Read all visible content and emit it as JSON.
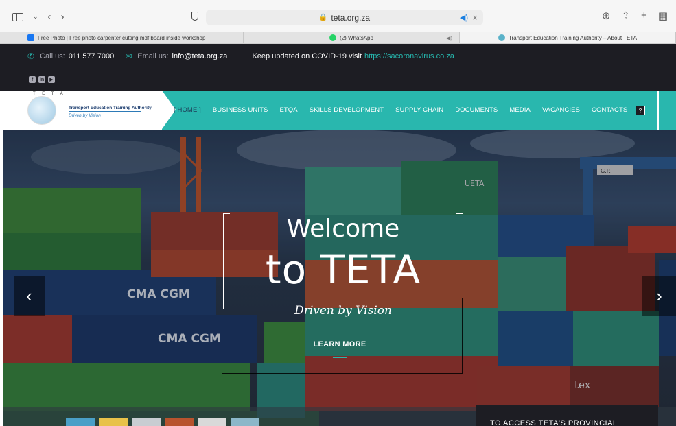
{
  "browser": {
    "url": "teta.org.za",
    "tabs": [
      {
        "label": "Free Photo | Free photo carpenter cutting mdf board inside workshop",
        "icon": "freepik-favicon"
      },
      {
        "label": "(2) WhatsApp",
        "icon": "whatsapp-favicon"
      },
      {
        "label": "Transport Education Training Authority – About TETA",
        "icon": "teta-favicon"
      }
    ]
  },
  "topbar": {
    "call_label": "Call us:",
    "call_value": "011 577 7000",
    "email_label": "Email us:",
    "email_value": "info@teta.org.za",
    "covid_text": "Keep updated on COVID-19 visit",
    "covid_link": "https://sacoronavirus.co.za",
    "social": [
      "facebook-icon",
      "linkedin-icon",
      "youtube-icon"
    ]
  },
  "logo": {
    "letters": "T E T A",
    "name": "Transport Education Training Authority",
    "tagline": "Driven by Vision"
  },
  "nav": {
    "items": [
      "[ HOME ]",
      "BUSINESS UNITS",
      "ETQA",
      "SKILLS DEVELOPMENT",
      "SUPPLY CHAIN",
      "DOCUMENTS",
      "MEDIA",
      "VACANCIES",
      "CONTACTS"
    ],
    "help_label": "?"
  },
  "hero": {
    "line1": "Welcome",
    "line2": "to TETA",
    "tagline": "Driven by Vision",
    "cta": "LEARN MORE",
    "prev": "‹",
    "next": "›",
    "thumb_colors": [
      "#4a9fc7",
      "#e8c24a",
      "#c9cdd2",
      "#b8532e",
      "#d9d9d9",
      "#8cb7c9"
    ],
    "scene_text": [
      "CMA CGM",
      "CMA CGM",
      "tex",
      "UETA",
      "G.P."
    ]
  },
  "provincial": {
    "text": "TO ACCESS TETA'S PROVINCIAL"
  },
  "colors": {
    "accent": "#29b7ae",
    "dark": "#1d1d23"
  }
}
